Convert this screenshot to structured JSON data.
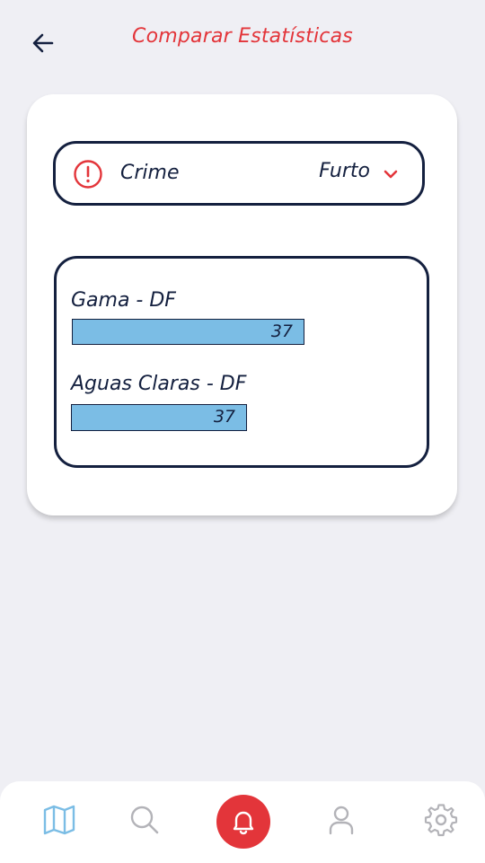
{
  "header": {
    "title": "Comparar Estatísticas",
    "back_icon": "arrow-left-icon"
  },
  "filter": {
    "label": "Crime",
    "selected": "Furto",
    "icon": "alert-circle-icon",
    "dropdown_icon": "chevron-down-icon"
  },
  "stats": [
    {
      "label": "Gama - DF",
      "value": "37",
      "fill": 0.62
    },
    {
      "label": "Aguas Claras - DF",
      "value": "37",
      "fill": 0.47
    }
  ],
  "nav": {
    "items": [
      {
        "name": "map",
        "icon": "map-icon",
        "active": true
      },
      {
        "name": "search",
        "icon": "search-icon",
        "active": false
      },
      {
        "name": "alert",
        "icon": "bell-icon",
        "active": false
      },
      {
        "name": "profile",
        "icon": "user-icon",
        "active": false
      },
      {
        "name": "settings",
        "icon": "gear-icon",
        "active": false
      }
    ]
  },
  "colors": {
    "accent": "#e3353a",
    "primary": "#14203f",
    "bar": "#7bbde5",
    "active_nav": "#7bbde5",
    "inactive_nav": "#b3b3b8",
    "background": "#efeff4"
  }
}
